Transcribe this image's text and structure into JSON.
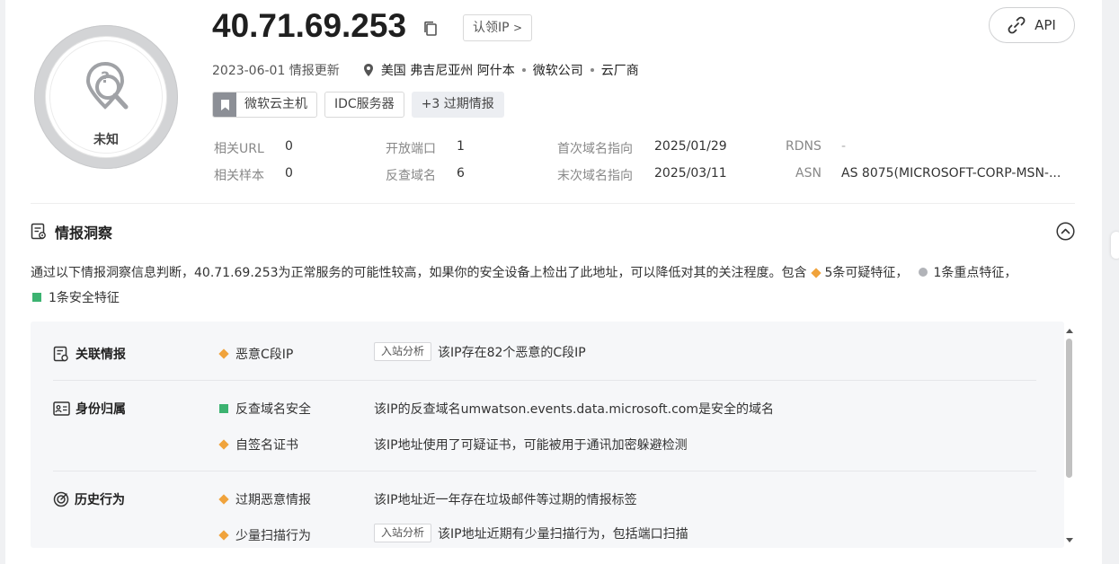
{
  "header": {
    "ip": "40.71.69.253",
    "claim_label": "认领IP",
    "claim_chevron": ">",
    "api_label": "API",
    "status_label": "未知",
    "updated": "2023-06-01 情报更新",
    "location": "美国 弗吉尼亚州 阿什本",
    "org": "微软公司",
    "category": "云厂商"
  },
  "tags": [
    {
      "label": "微软云主机"
    },
    {
      "label": "IDC服务器"
    },
    {
      "label": "+3 过期情报"
    }
  ],
  "stats": {
    "related_url_label": "相关URL",
    "related_url": "0",
    "related_sample_label": "相关样本",
    "related_sample": "0",
    "open_ports_label": "开放端口",
    "open_ports": "1",
    "reverse_domain_label": "反查域名",
    "reverse_domain": "6",
    "first_domain_label": "首次域名指向",
    "first_domain": "2025/01/29",
    "last_domain_label": "末次域名指向",
    "last_domain": "2025/03/11",
    "rdns_label": "RDNS",
    "rdns": "-",
    "asn_label": "ASN",
    "asn": "AS 8075(MICROSOFT-CORP-MSN-..."
  },
  "insight": {
    "title": "情报洞察",
    "summary_text": "通过以下情报洞察信息判断，40.71.69.253为正常服务的可能性较高，如果你的安全设备上检出了此地址，可以降低对其的关注程度。包含",
    "suspicious": "5条可疑特征，",
    "key": "1条重点特征，",
    "safe": "1条安全特征",
    "groups": [
      {
        "title": "关联情报",
        "items": [
          {
            "label": "恶意C段IP",
            "badge": "入站分析",
            "desc": "该IP存在82个恶意的C段IP"
          }
        ]
      },
      {
        "title": "身份归属",
        "items": [
          {
            "label": "反查域名安全",
            "desc": "该IP的反查域名umwatson.events.data.microsoft.com是安全的域名"
          },
          {
            "label": "自签名证书",
            "desc": "该IP地址使用了可疑证书，可能被用于通讯加密躲避检测"
          }
        ]
      },
      {
        "title": "历史行为",
        "items": [
          {
            "label": "过期恶意情报",
            "desc": "该IP地址近一年存在垃圾邮件等过期的情报标签"
          },
          {
            "label": "少量扫描行为",
            "badge": "入站分析",
            "desc": "该IP地址近期有少量扫描行为，包括端口扫描"
          }
        ]
      }
    ]
  },
  "icons": {
    "status": "unknown-search-icon",
    "copy": "copy-icon",
    "api": "link-icon",
    "location": "location-pin-icon",
    "section": "report-icon",
    "collapse": "chevron-up-icon"
  },
  "colors": {
    "suspicious": "#f0a33c",
    "key": "#b1b3b8",
    "safe": "#3cb371"
  }
}
